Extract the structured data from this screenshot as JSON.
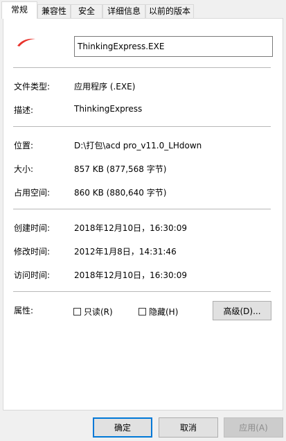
{
  "tabs": [
    "常规",
    "兼容性",
    "安全",
    "详细信息",
    "以前的版本"
  ],
  "filename": "ThinkingExpress.EXE",
  "rows": {
    "type": {
      "label": "文件类型:",
      "value": "应用程序 (.EXE)"
    },
    "desc": {
      "label": "描述:",
      "value": "ThinkingExpress"
    },
    "location": {
      "label": "位置:",
      "value": "D:\\打包\\acd pro_v11.0_LHdown"
    },
    "size": {
      "label": "大小:",
      "value": "857 KB (877,568 字节)"
    },
    "disk": {
      "label": "占用空间:",
      "value": "860 KB (880,640 字节)"
    },
    "created": {
      "label": "创建时间:",
      "value": "2018年12月10日，16:30:09"
    },
    "modified": {
      "label": "修改时间:",
      "value": "2012年1月8日，14:31:46"
    },
    "accessed": {
      "label": "访问时间:",
      "value": "2018年12月10日，16:30:09"
    }
  },
  "attributes": {
    "label": "属性:",
    "readonly": "只读(R)",
    "hidden": "隐藏(H)",
    "advanced": "高级(D)..."
  },
  "buttons": {
    "ok": "确定",
    "cancel": "取消",
    "apply": "应用(A)"
  },
  "colors": {
    "icon": "#e8322b",
    "default_border": "#0078d7"
  }
}
